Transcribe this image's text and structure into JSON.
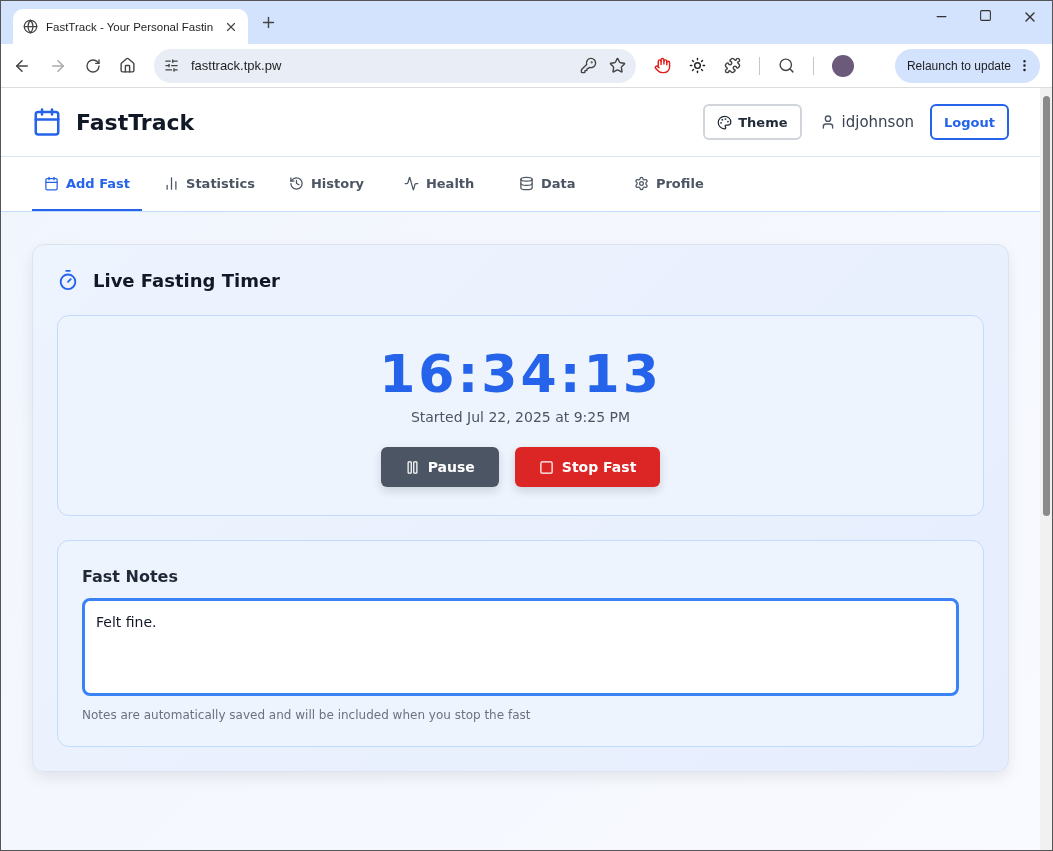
{
  "browser": {
    "tab_title": "FastTrack - Your Personal Fastin",
    "url": "fasttrack.tpk.pw",
    "relaunch": "Relaunch to update"
  },
  "header": {
    "brand": "FastTrack",
    "theme_button": "Theme",
    "user": "idjohnson",
    "logout": "Logout"
  },
  "nav": [
    {
      "label": "Add Fast",
      "kind": "calendar",
      "selected": true
    },
    {
      "label": "Statistics",
      "kind": "chart",
      "selected": false
    },
    {
      "label": "History",
      "kind": "history",
      "selected": false
    },
    {
      "label": "Health",
      "kind": "activity",
      "selected": false
    },
    {
      "label": "Data",
      "kind": "database",
      "selected": false
    },
    {
      "label": "Profile",
      "kind": "settings",
      "selected": false
    }
  ],
  "timer": {
    "title": "Live Fasting Timer",
    "time": "16:34:13",
    "started": "Started Jul 22, 2025 at 9:25 PM",
    "buttons": [
      {
        "label": "Pause",
        "kind": "pause"
      },
      {
        "label": "Stop Fast",
        "kind": "stop"
      }
    ]
  },
  "notes": {
    "title": "Fast Notes",
    "value": "Felt fine.",
    "hint": "Notes are automatically saved and will be included when you stop the fast"
  }
}
